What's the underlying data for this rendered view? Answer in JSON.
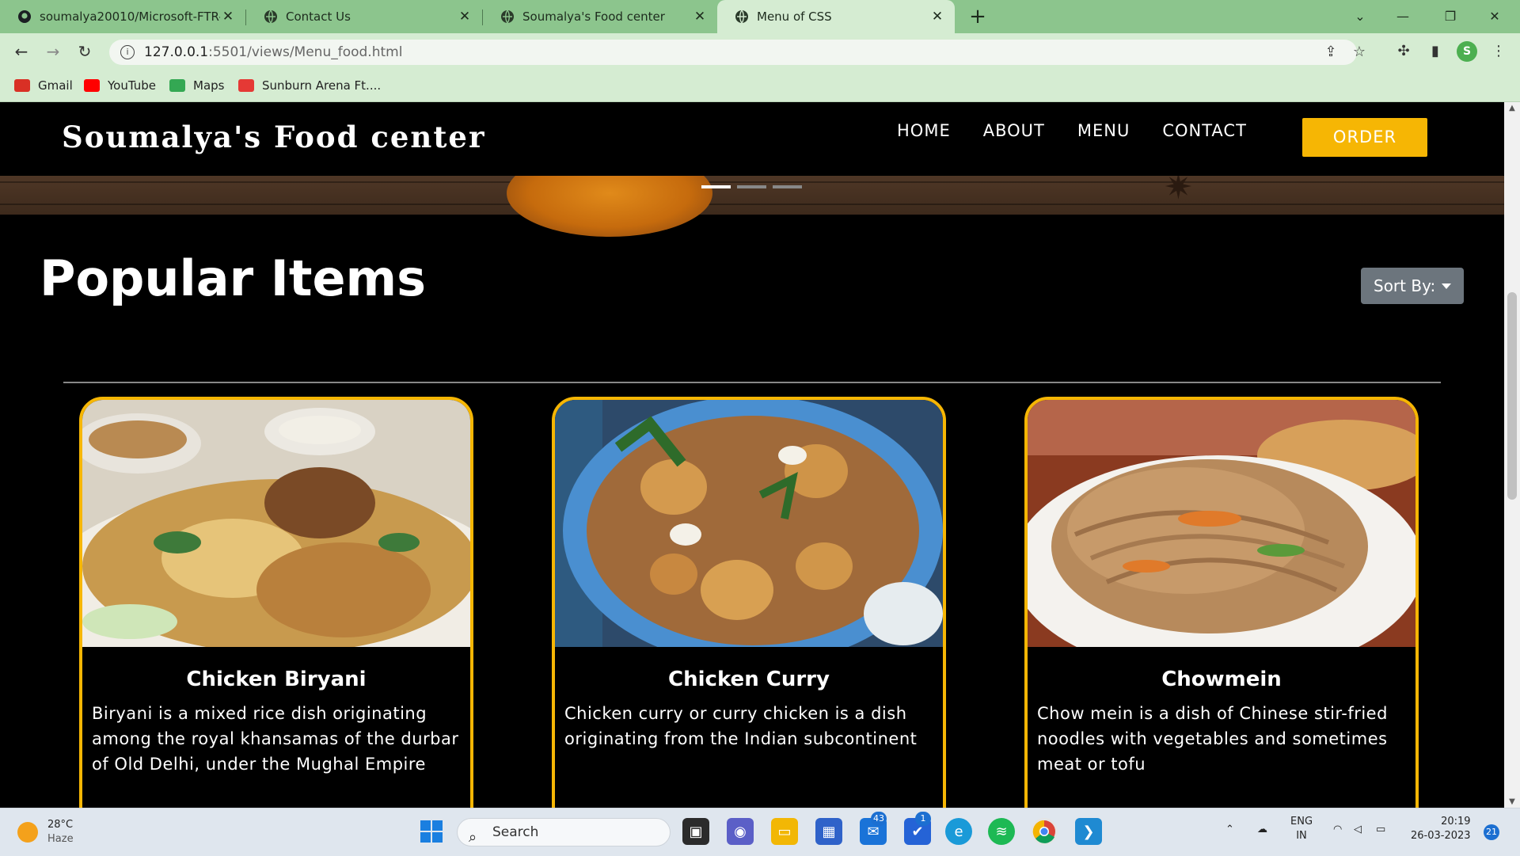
{
  "browser": {
    "tabs": [
      {
        "title": "soumalya20010/Microsoft-FTR-p",
        "icon": "github-icon"
      },
      {
        "title": "Contact Us",
        "icon": "globe-icon"
      },
      {
        "title": "Soumalya's Food center",
        "icon": "globe-icon"
      },
      {
        "title": "Menu of CSS",
        "icon": "globe-icon",
        "active": true
      }
    ],
    "url_host": "127.0.0.1",
    "url_path": ":5501/views/Menu_food.html",
    "bookmarks": [
      {
        "label": "Gmail",
        "icon": "gmail-icon",
        "color": "#d93025"
      },
      {
        "label": "YouTube",
        "icon": "youtube-icon",
        "color": "#ff0000"
      },
      {
        "label": "Maps",
        "icon": "maps-icon",
        "color": "#34a853"
      },
      {
        "label": "Sunburn Arena Ft....",
        "icon": "sunburn-icon",
        "color": "#e53935"
      }
    ],
    "profile_initial": "S"
  },
  "site": {
    "brand": "Soumalya's Food center",
    "nav": [
      "HOME",
      "ABOUT",
      "MENU",
      "CONTACT"
    ],
    "order_label": "ORDER",
    "accent": "#f6b604",
    "carousel": {
      "slides": 3,
      "active": 0
    }
  },
  "menu": {
    "heading": "Popular Items",
    "sort_label": "Sort By:",
    "items": [
      {
        "name": "Chicken Biryani",
        "description": "Biryani is a mixed rice dish originating among the royal khansamas of the durbar of Old Delhi, under the Mughal Empire"
      },
      {
        "name": "Chicken Curry",
        "description": "Chicken curry or curry chicken is a dish originating from the Indian subcontinent"
      },
      {
        "name": "Chowmein",
        "description": "Chow mein is a dish of Chinese stir-fried noodles with vegetables and sometimes meat or tofu"
      }
    ]
  },
  "taskbar": {
    "weather_temp": "28°C",
    "weather_desc": "Haze",
    "search_placeholder": "Search",
    "mail_badge": "43",
    "todo_badge": "1",
    "lang_top": "ENG",
    "lang_bottom": "IN",
    "time": "20:19",
    "date": "26-03-2023",
    "notif_count": "21"
  }
}
